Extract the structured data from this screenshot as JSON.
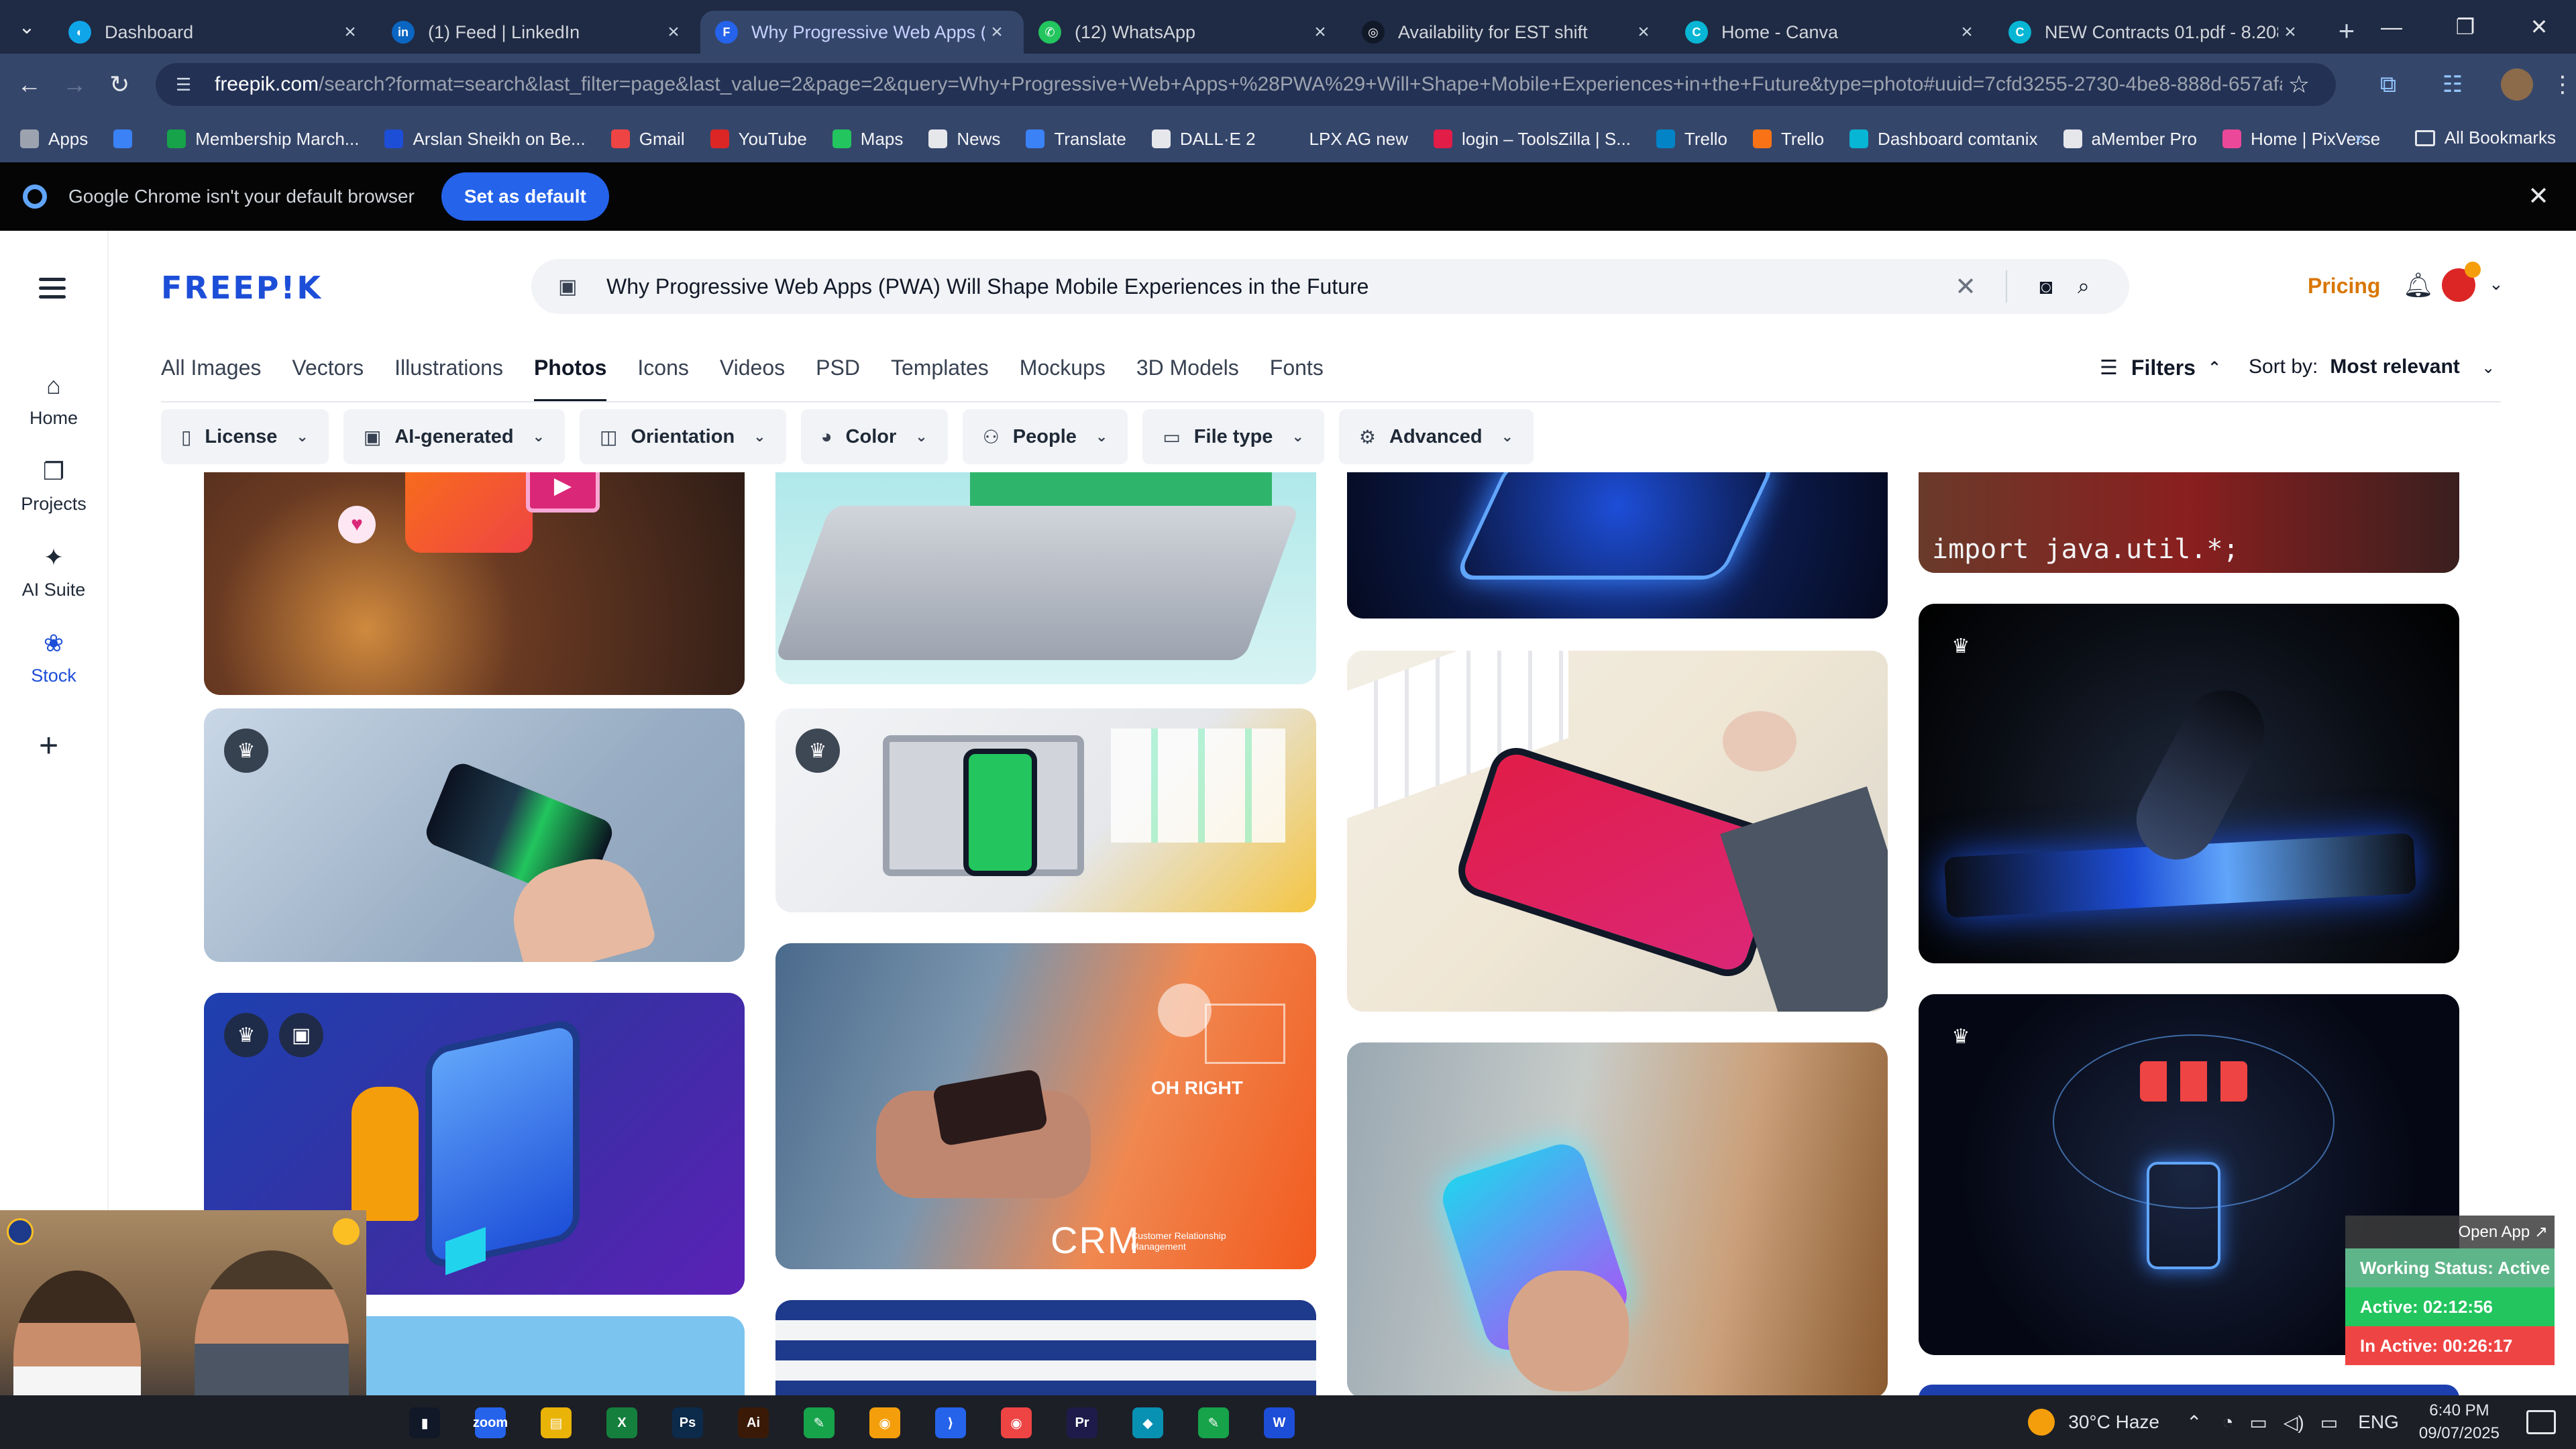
{
  "browser": {
    "tabs": [
      {
        "title": "Dashboard",
        "color": "#0ea5e9",
        "glyph": "◐"
      },
      {
        "title": "(1) Feed | LinkedIn",
        "color": "#0a66c2",
        "glyph": "in"
      },
      {
        "title": "Why Progressive Web Apps (PWA",
        "color": "#2563eb",
        "glyph": "F"
      },
      {
        "title": "(12) WhatsApp",
        "color": "#22c55e",
        "glyph": "✆"
      },
      {
        "title": "Availability for EST shift",
        "color": "#111827",
        "glyph": "◎"
      },
      {
        "title": "Home - Canva",
        "color": "#06b6d4",
        "glyph": "C"
      },
      {
        "title": "NEW Contracts 01.pdf - 8.208",
        "color": "#06b6d4",
        "glyph": "C"
      }
    ],
    "url_domain": "freepik.com",
    "url_path": "/search?format=search&last_filter=page&last_value=2&page=2&query=Why+Progressive+Web+Apps+%28PWA%29+Will+Shape+Mobile+Experiences+in+the+Future&type=photo#uuid=7cfd3255-2730-4be8-888d-657afa59190a",
    "bookmarks": [
      {
        "label": "Apps",
        "color": "#9ca3af"
      },
      {
        "label": "",
        "color": "#3b82f6"
      },
      {
        "label": "Membership March...",
        "color": "#16a34a"
      },
      {
        "label": "Arslan Sheikh on Be...",
        "color": "#1d4ed8"
      },
      {
        "label": "Gmail",
        "color": "#ef4444"
      },
      {
        "label": "YouTube",
        "color": "#dc2626"
      },
      {
        "label": "Maps",
        "color": "#22c55e"
      },
      {
        "label": "News",
        "color": "#e5e7eb"
      },
      {
        "label": "Translate",
        "color": "#3b82f6"
      },
      {
        "label": "DALL·E 2",
        "color": "#e5e7eb"
      },
      {
        "label": "LPX AG new",
        "color": "#35466b"
      },
      {
        "label": "login – ToolsZilla | S...",
        "color": "#e11d48"
      },
      {
        "label": "Trello",
        "color": "#0284c7"
      },
      {
        "label": "Trello",
        "color": "#f97316"
      },
      {
        "label": "Dashboard comtanix",
        "color": "#06b6d4"
      },
      {
        "label": "aMember Pro",
        "color": "#e5e7eb"
      },
      {
        "label": "Home | PixVerse",
        "color": "#ec4899"
      }
    ],
    "all_bookmarks": "All Bookmarks"
  },
  "infobar": {
    "message": "Google Chrome isn't your default browser",
    "button": "Set as default"
  },
  "freepik": {
    "logo": "FREEP!K",
    "search_query": "Why Progressive Web Apps (PWA) Will Shape Mobile Experiences in the Future",
    "pricing": "Pricing",
    "sidenav": [
      {
        "label": "Home",
        "glyph": "⌂"
      },
      {
        "label": "Projects",
        "glyph": "❐"
      },
      {
        "label": "AI Suite",
        "glyph": "✦"
      },
      {
        "label": "Stock",
        "glyph": "❀"
      }
    ],
    "type_tabs": [
      "All Images",
      "Vectors",
      "Illustrations",
      "Photos",
      "Icons",
      "Videos",
      "PSD",
      "Templates",
      "Mockups",
      "3D Models",
      "Fonts"
    ],
    "active_tab": "Photos",
    "filters_label": "Filters",
    "sort_label": "Sort by:",
    "sort_value": "Most relevant",
    "chips": [
      {
        "label": "License",
        "glyph": "▯"
      },
      {
        "label": "AI-generated",
        "glyph": "▣"
      },
      {
        "label": "Orientation",
        "glyph": "◫"
      },
      {
        "label": "Color",
        "glyph": "◕"
      },
      {
        "label": "People",
        "glyph": "⚇"
      },
      {
        "label": "File type",
        "glyph": "▭"
      },
      {
        "label": "Advanced",
        "glyph": "⚙"
      }
    ],
    "images": {
      "crm_title": "CRM",
      "crm_sub": "Customer Relationship Management",
      "oh_right": "OH RIGHT",
      "java_caption": "import java.util.*;"
    }
  },
  "widget": {
    "open_app": "Open App ↗",
    "working": "Working Status: Active",
    "active": "Active: 02:12:56",
    "inactive": "In Active: 00:26:17"
  },
  "taskbar": {
    "apps": [
      {
        "glyph": "▮",
        "color": "#111827"
      },
      {
        "glyph": "zoom",
        "color": "#2563eb"
      },
      {
        "glyph": "▤",
        "color": "#eab308"
      },
      {
        "glyph": "X",
        "color": "#15803d"
      },
      {
        "glyph": "Ps",
        "color": "#0c2a4a"
      },
      {
        "glyph": "Ai",
        "color": "#3a1a07"
      },
      {
        "glyph": "✎",
        "color": "#16a34a"
      },
      {
        "glyph": "◉",
        "color": "#f59e0b"
      },
      {
        "glyph": "⟩",
        "color": "#2563eb"
      },
      {
        "glyph": "◉",
        "color": "#ef4444"
      },
      {
        "glyph": "Pr",
        "color": "#1e1b4b"
      },
      {
        "glyph": "◆",
        "color": "#0891b2"
      },
      {
        "glyph": "✎",
        "color": "#16a34a"
      },
      {
        "glyph": "W",
        "color": "#1d4ed8"
      }
    ],
    "weather": "30°C  Haze",
    "lang": "ENG",
    "time": "6:40 PM",
    "date": "09/07/2025"
  }
}
